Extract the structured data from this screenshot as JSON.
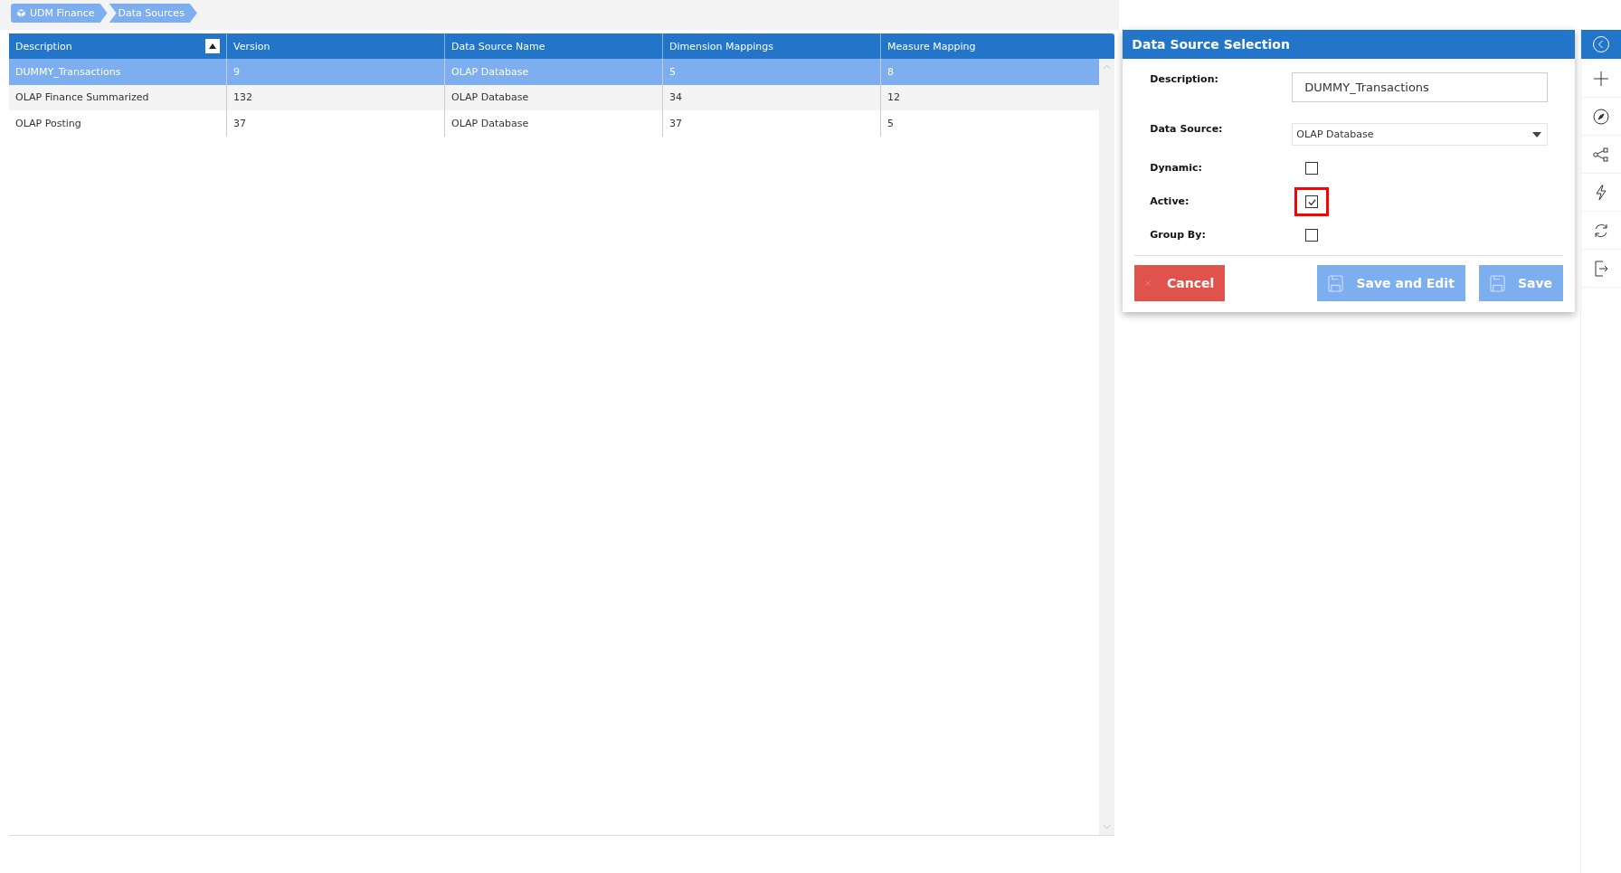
{
  "breadcrumb": [
    {
      "kind": "root",
      "label": "UDM Finance"
    },
    {
      "kind": "page",
      "label": "Data Sources"
    }
  ],
  "table": {
    "columns": [
      {
        "label": "Description",
        "sorted": true
      },
      {
        "label": "Version",
        "sorted": false
      },
      {
        "label": "Data Source Name",
        "sorted": false
      },
      {
        "label": "Dimension Mappings",
        "sorted": false
      },
      {
        "label": "Measure Mapping",
        "sorted": false
      }
    ],
    "rows": [
      {
        "selected": true,
        "cells": [
          "DUMMY_Transactions",
          "9",
          "OLAP Database",
          "5",
          "8"
        ]
      },
      {
        "selected": false,
        "cells": [
          "OLAP Finance Summarized",
          "132",
          "OLAP Database",
          "34",
          "12"
        ]
      },
      {
        "selected": false,
        "cells": [
          "OLAP Posting",
          "37",
          "OLAP Database",
          "37",
          "5"
        ]
      }
    ]
  },
  "dialog": {
    "title": "Data Source Selection",
    "fields": [
      {
        "kind": "text",
        "label": "Description:",
        "value": "DUMMY_Transactions"
      },
      {
        "kind": "select",
        "label": "Data Source:",
        "value": "OLAP Database"
      },
      {
        "kind": "checkbox",
        "label": "Dynamic:",
        "checked": false,
        "highlighted": false
      },
      {
        "kind": "checkbox",
        "label": "Active:",
        "checked": true,
        "highlighted": true
      },
      {
        "kind": "checkbox",
        "label": "Group By:",
        "checked": false,
        "highlighted": false
      }
    ],
    "buttons": [
      {
        "kind": "cancel",
        "label": "Cancel"
      },
      {
        "kind": "save",
        "label": "Save and Edit"
      },
      {
        "kind": "save",
        "label": "Save"
      }
    ]
  },
  "sidebar": {
    "items": [
      {
        "kind": "collapse",
        "selected": true
      },
      {
        "kind": "add",
        "selected": false
      },
      {
        "kind": "compass",
        "selected": false
      },
      {
        "kind": "share",
        "selected": false
      },
      {
        "kind": "bolt",
        "selected": false
      },
      {
        "kind": "refresh",
        "selected": false
      },
      {
        "kind": "exit",
        "selected": false
      }
    ]
  }
}
